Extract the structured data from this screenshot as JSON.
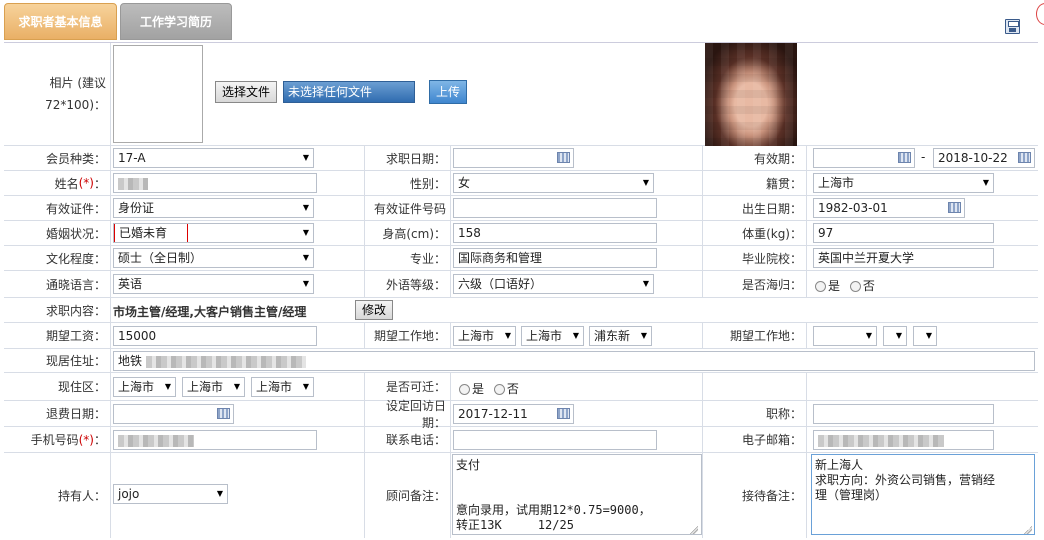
{
  "tabs": [
    {
      "label": "求职者基本信息"
    },
    {
      "label": "工作学习简历"
    }
  ],
  "photo": {
    "label_line1": "相片 (建议",
    "label_line2": "72*100)：",
    "choose_button": "选择文件",
    "file_status": "未选择任何文件",
    "upload_button": "上传"
  },
  "fields": {
    "member_type": {
      "label": "会员种类：",
      "value": "17-A"
    },
    "apply_date": {
      "label": "求职日期：",
      "value": ""
    },
    "valid_period": {
      "label": "有效期：",
      "start": "",
      "separator": "-",
      "end": "2018-10-22"
    },
    "name": {
      "label": "姓名",
      "req": "(*)",
      "colon": "："
    },
    "gender": {
      "label": "性别：",
      "value": "女"
    },
    "native_place": {
      "label": "籍贯：",
      "value": "上海市"
    },
    "id_type": {
      "label": "有效证件：",
      "value": "身份证"
    },
    "id_number": {
      "label": "有效证件号码",
      "value": ""
    },
    "birth_date": {
      "label": "出生日期：",
      "value": "1982-03-01"
    },
    "marital": {
      "label": "婚姻状况：",
      "value": "已婚未育"
    },
    "height": {
      "label": "身高(cm)：",
      "value": "158"
    },
    "weight": {
      "label": "体重(kg)：",
      "value": "97"
    },
    "education": {
      "label": "文化程度：",
      "value": "硕士（全日制）"
    },
    "major": {
      "label": "专业：",
      "value": "国际商务和管理"
    },
    "school": {
      "label": "毕业院校：",
      "value": "英国中兰开夏大学"
    },
    "language": {
      "label": "通晓语言：",
      "value": "英语"
    },
    "language_level": {
      "label": "外语等级：",
      "value": "六级（口语好）"
    },
    "overseas_return": {
      "label": "是否海归：",
      "yes": "是",
      "no": "否"
    },
    "job_content": {
      "label": "求职内容：",
      "value": "市场主管/经理,大客户销售主管/经理",
      "button": "修改"
    },
    "expected_salary": {
      "label": "期望工资：",
      "value": "15000"
    },
    "work_place1": {
      "label": "期望工作地：",
      "v1": "上海市",
      "v2": "上海市",
      "v3": "浦东新"
    },
    "work_place2": {
      "label": "期望工作地："
    },
    "address": {
      "label": "现居住址：",
      "value": "地铁"
    },
    "district": {
      "label": "现住区：",
      "v1": "上海市",
      "v2": "上海市",
      "v3": "上海市"
    },
    "relocate": {
      "label": "是否可迁：",
      "yes": "是",
      "no": "否"
    },
    "refund_date": {
      "label": "退费日期：",
      "value": ""
    },
    "revisit_date": {
      "label": "设定回访日期：",
      "value": "2017-12-11"
    },
    "title": {
      "label": "职称：",
      "value": ""
    },
    "mobile": {
      "label": "手机号码",
      "req": "(*)",
      "colon": "："
    },
    "phone": {
      "label": "联系电话：",
      "value": ""
    },
    "email": {
      "label": "电子邮箱："
    },
    "holder": {
      "label": "持有人：",
      "value": "jojo"
    },
    "consultant_note": {
      "label": "顾问备注：",
      "value": "支付\n\n\n意向录用，试用期12*0.75=9000，\n转正13K     12/25"
    },
    "reception_note": {
      "label": "接待备注：",
      "value": "新上海人\n求职方向：外资公司销售，营销经\n理（管理岗）"
    }
  }
}
